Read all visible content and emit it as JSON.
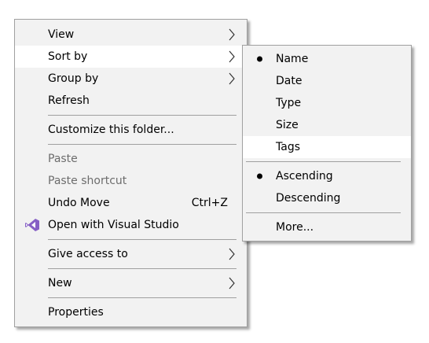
{
  "main_menu": {
    "view": "View",
    "sort_by": "Sort by",
    "group_by": "Group by",
    "refresh": "Refresh",
    "customize": "Customize this folder...",
    "paste": "Paste",
    "paste_shortcut": "Paste shortcut",
    "undo_move": "Undo Move",
    "undo_shortcut": "Ctrl+Z",
    "open_vs": "Open with Visual Studio",
    "give_access": "Give access to",
    "new": "New",
    "properties": "Properties"
  },
  "sort_menu": {
    "name": "Name",
    "date": "Date",
    "type": "Type",
    "size": "Size",
    "tags": "Tags",
    "ascending": "Ascending",
    "descending": "Descending",
    "more": "More..."
  },
  "icons": {
    "submenu_arrow": "chevron-right-icon",
    "visual_studio": "visual-studio-icon",
    "selected_bullet": "bullet-icon"
  },
  "colors": {
    "menu_background": "#f2f2f2",
    "highlight": "#ffffff",
    "disabled_text": "#6d6d6d",
    "separator": "#a0a0a0",
    "vs_purple": "#865fc5"
  }
}
